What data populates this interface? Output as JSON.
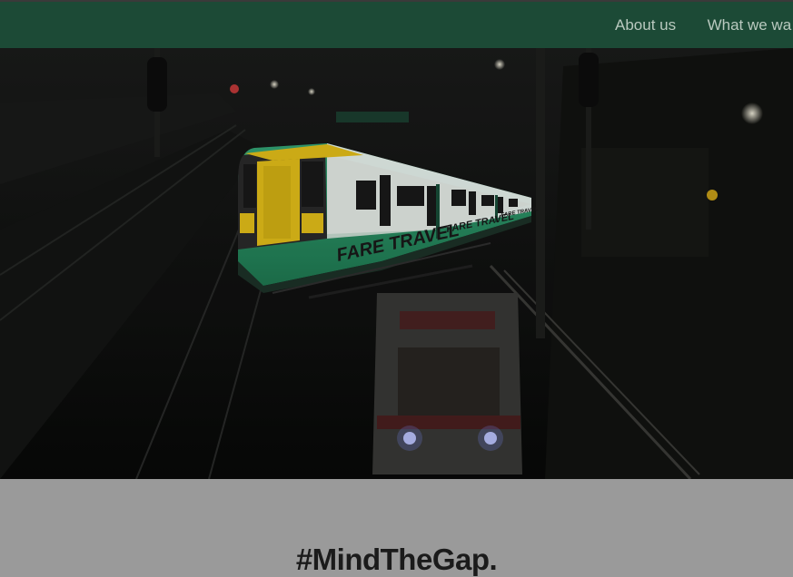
{
  "nav": {
    "items": [
      {
        "label": "About us"
      },
      {
        "label": "What we wa"
      }
    ]
  },
  "hero": {
    "train_brand": "FARE TRAVEL",
    "train_brand_2": "FARE TRAVEL",
    "train_brand_3": "FARE TRAVEL",
    "overlay_color": "#000000"
  },
  "content": {
    "tagline": "#MindTheGap."
  },
  "colors": {
    "topbar": "#1c4a36",
    "nav_text": "#b9c9bf",
    "train_green": "#2f9b6d",
    "train_yellow": "#e8c21a",
    "page_bg": "#9a9a9a"
  }
}
